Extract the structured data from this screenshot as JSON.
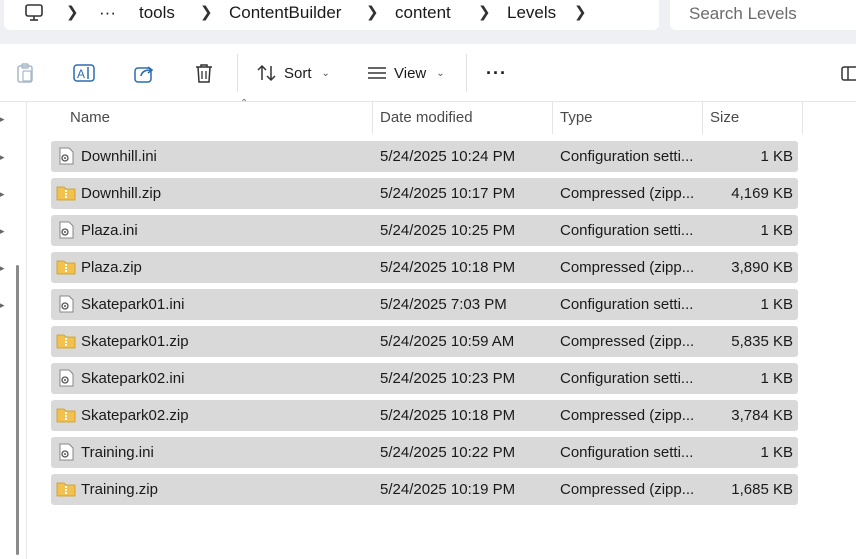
{
  "address_bar": {
    "crumbs": [
      "tools",
      "ContentBuilder",
      "content",
      "Levels"
    ],
    "overflow": "···"
  },
  "search": {
    "placeholder": "Search Levels"
  },
  "toolbar": {
    "sort_label": "Sort",
    "view_label": "View",
    "more_label": "···"
  },
  "columns": {
    "name": "Name",
    "date": "Date modified",
    "type": "Type",
    "size": "Size"
  },
  "files": [
    {
      "name": "Downhill.ini",
      "date": "5/24/2025 10:24 PM",
      "type": "Configuration setti...",
      "size": "1 KB",
      "kind": "ini"
    },
    {
      "name": "Downhill.zip",
      "date": "5/24/2025 10:17 PM",
      "type": "Compressed (zipp...",
      "size": "4,169 KB",
      "kind": "zip"
    },
    {
      "name": "Plaza.ini",
      "date": "5/24/2025 10:25 PM",
      "type": "Configuration setti...",
      "size": "1 KB",
      "kind": "ini"
    },
    {
      "name": "Plaza.zip",
      "date": "5/24/2025 10:18 PM",
      "type": "Compressed (zipp...",
      "size": "3,890 KB",
      "kind": "zip"
    },
    {
      "name": "Skatepark01.ini",
      "date": "5/24/2025 7:03 PM",
      "type": "Configuration setti...",
      "size": "1 KB",
      "kind": "ini"
    },
    {
      "name": "Skatepark01.zip",
      "date": "5/24/2025 10:59 AM",
      "type": "Compressed (zipp...",
      "size": "5,835 KB",
      "kind": "zip"
    },
    {
      "name": "Skatepark02.ini",
      "date": "5/24/2025 10:23 PM",
      "type": "Configuration setti...",
      "size": "1 KB",
      "kind": "ini"
    },
    {
      "name": "Skatepark02.zip",
      "date": "5/24/2025 10:18 PM",
      "type": "Compressed (zipp...",
      "size": "3,784 KB",
      "kind": "zip"
    },
    {
      "name": "Training.ini",
      "date": "5/24/2025 10:22 PM",
      "type": "Configuration setti...",
      "size": "1 KB",
      "kind": "ini"
    },
    {
      "name": "Training.zip",
      "date": "5/24/2025 10:19 PM",
      "type": "Compressed (zipp...",
      "size": "1,685 KB",
      "kind": "zip"
    }
  ],
  "colors": {
    "row_selected": "#d9d9d9",
    "zip_folder": "#f2c14e",
    "accent": "#2b6cb0"
  }
}
